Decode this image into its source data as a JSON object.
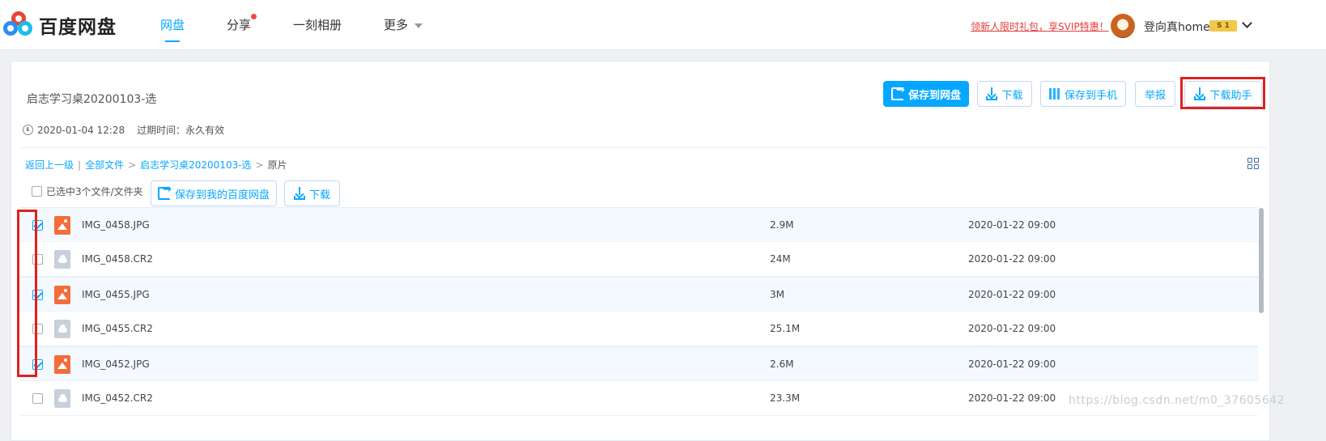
{
  "app": {
    "logo_text": "百度网盘"
  },
  "nav": {
    "items": [
      {
        "label": "网盘",
        "active": true
      },
      {
        "label": "分享",
        "dot": true
      },
      {
        "label": "一刻相册"
      },
      {
        "label": "更多",
        "caret": true
      }
    ]
  },
  "header": {
    "promo": "领新人限时礼包，享SVIP特惠！",
    "username": "登向真home",
    "vip_badge": "S 1"
  },
  "share": {
    "title": "启志学习桌20200103-选",
    "date": "2020-01-04 12:28",
    "expire": "过期时间：永久有效"
  },
  "actions": {
    "save": "保存到网盘",
    "download": "下载",
    "save_phone": "保存到手机",
    "report": "举报",
    "assistant": "下载助手"
  },
  "breadcrumb": {
    "back": "返回上一级",
    "sep": "|",
    "all": "全部文件",
    "arrow": ">",
    "folder": "启志学习桌20200103-选",
    "current": "原片"
  },
  "toolbar": {
    "selected": "已选中3个文件/文件夹",
    "save_mine": "保存到我的百度网盘",
    "download": "下载"
  },
  "files": [
    {
      "name": "IMG_0458.JPG",
      "size": "2.9M",
      "date": "2020-01-22 09:00",
      "type": "jpg",
      "checked": true
    },
    {
      "name": "IMG_0458.CR2",
      "size": "24M",
      "date": "2020-01-22 09:00",
      "type": "raw",
      "checked": false
    },
    {
      "name": "IMG_0455.JPG",
      "size": "3M",
      "date": "2020-01-22 09:00",
      "type": "jpg",
      "checked": true
    },
    {
      "name": "IMG_0455.CR2",
      "size": "25.1M",
      "date": "2020-01-22 09:00",
      "type": "raw",
      "checked": false
    },
    {
      "name": "IMG_0452.JPG",
      "size": "2.6M",
      "date": "2020-01-22 09:00",
      "type": "jpg",
      "checked": true
    },
    {
      "name": "IMG_0452.CR2",
      "size": "23.3M",
      "date": "2020-01-22 09:00",
      "type": "raw",
      "checked": false
    }
  ],
  "watermark": "https://blog.csdn.net/m0_37605642",
  "colors": {
    "accent": "#06a7ff",
    "highlight": "#e02020",
    "promo": "#e43c3c"
  }
}
